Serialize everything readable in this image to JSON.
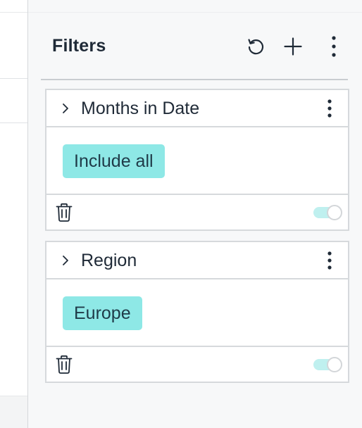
{
  "panel": {
    "title": "Filters",
    "actions": [
      {
        "name": "reset",
        "icon": "reset-icon"
      },
      {
        "name": "add",
        "icon": "plus-icon"
      },
      {
        "name": "more",
        "icon": "kebab-menu-icon"
      }
    ]
  },
  "filters": [
    {
      "label": "Months in Date",
      "selection": "Include all",
      "enabled": true
    },
    {
      "label": "Region",
      "selection": "Europe",
      "enabled": true
    }
  ],
  "colors": {
    "chip_background": "#8ee8e6",
    "toggle_track_on": "#bff0ef",
    "panel_background": "#f7f8f9",
    "text": "#1f2a37"
  }
}
